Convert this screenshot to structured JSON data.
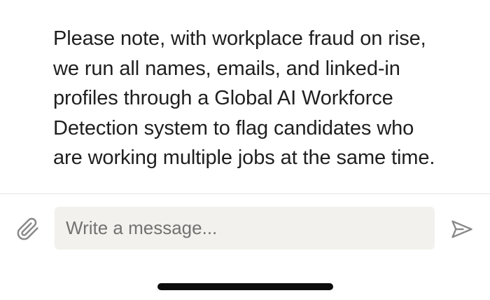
{
  "message": {
    "lines": [
      "Please note, with workplace fraud on rise,",
      "we run all names, emails, and linked-in",
      "profiles through a Global AI Workforce",
      "Detection system to flag candidates who",
      "are working multiple jobs at the same time."
    ]
  },
  "composer": {
    "placeholder": "Write a message...",
    "attach_icon": "paperclip-icon",
    "send_icon": "send-icon"
  },
  "colors": {
    "text": "#1f1f1f",
    "input_background": "#f2f1ed",
    "placeholder": "#727272",
    "icon": "#8a8a8a",
    "divider": "#e3e3e3",
    "home_indicator": "#0c0c0c"
  }
}
